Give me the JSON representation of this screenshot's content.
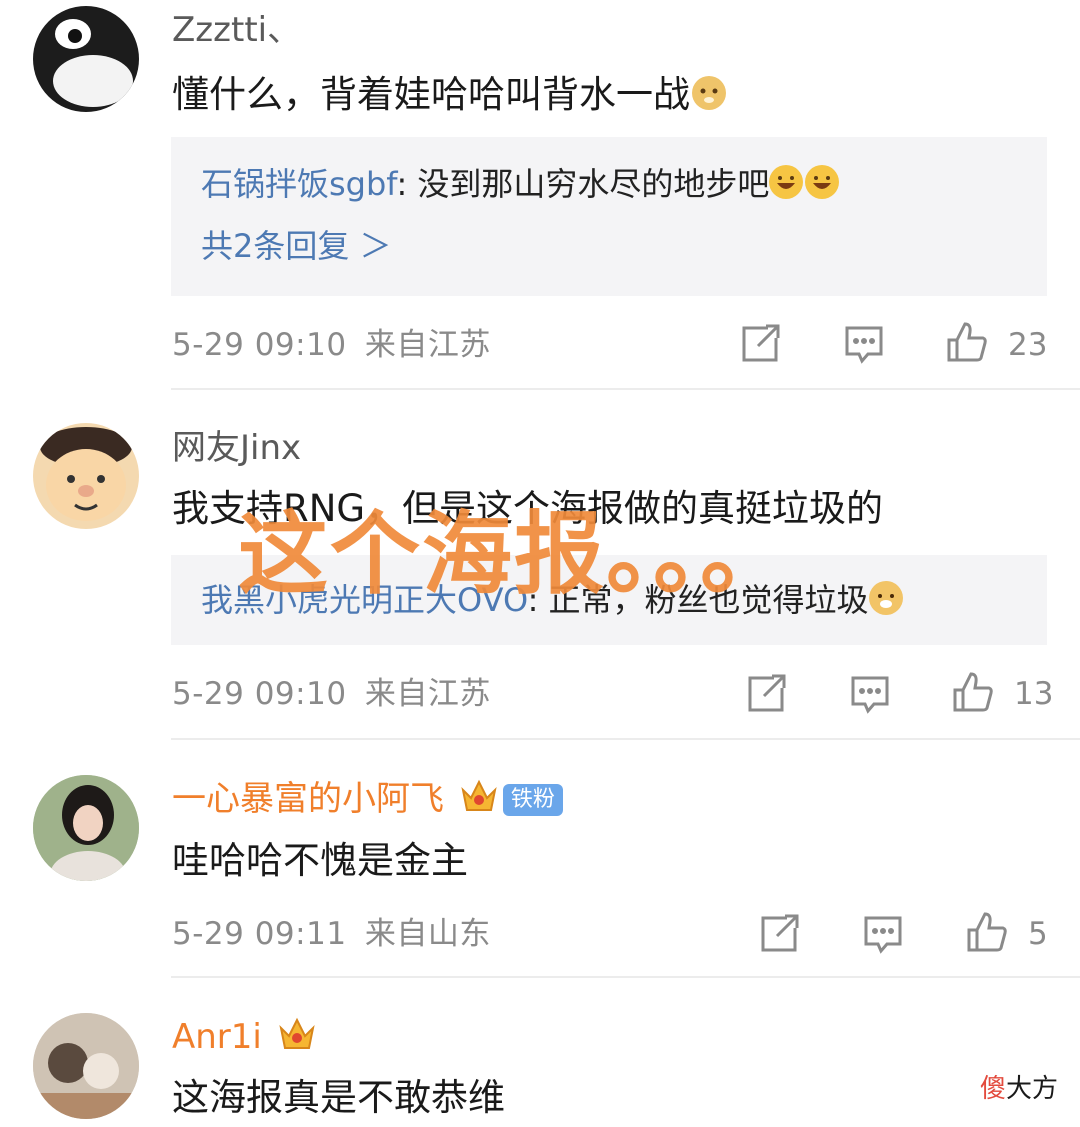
{
  "comments": [
    {
      "username": "Zzztti、",
      "text": "懂什么，背着娃哈哈叫背水一战",
      "reply": {
        "name": "石锅拌饭sgbf",
        "sep": ": ",
        "text": "没到那山穷水尽的地步吧",
        "more": "共2条回复 ＞"
      },
      "time": "5-29 09:10",
      "location": "来自江苏",
      "likes": "23"
    },
    {
      "username": "网友Jinx",
      "text": "我支持RNG，但是这个海报做的真挺垃圾的",
      "reply": {
        "name": "我黑小虎光明正大OVO",
        "sep": ": ",
        "text": "正常，粉丝也觉得垃圾"
      },
      "time": "5-29 09:10",
      "location": "来自江苏",
      "likes": "13"
    },
    {
      "username": "一心暴富的小阿飞",
      "badge": "铁粉",
      "text": "哇哈哈不愧是金主",
      "time": "5-29 09:11",
      "location": "来自山东",
      "likes": "5"
    },
    {
      "username": "Anr1i",
      "text": "这海报真是不敢恭维"
    }
  ],
  "overlay_text": "这个海报。。。",
  "watermark": {
    "part1": "傻",
    "part2": "大方"
  },
  "colors": {
    "accent_orange": "#f07f2b",
    "link_blue": "#4d79b3",
    "overlay": "#f08a3a"
  },
  "icons": [
    "share-icon",
    "comment-icon",
    "like-icon",
    "vip-crown-icon",
    "laugh-emoji",
    "doge-emoji",
    "dog-emoji"
  ]
}
